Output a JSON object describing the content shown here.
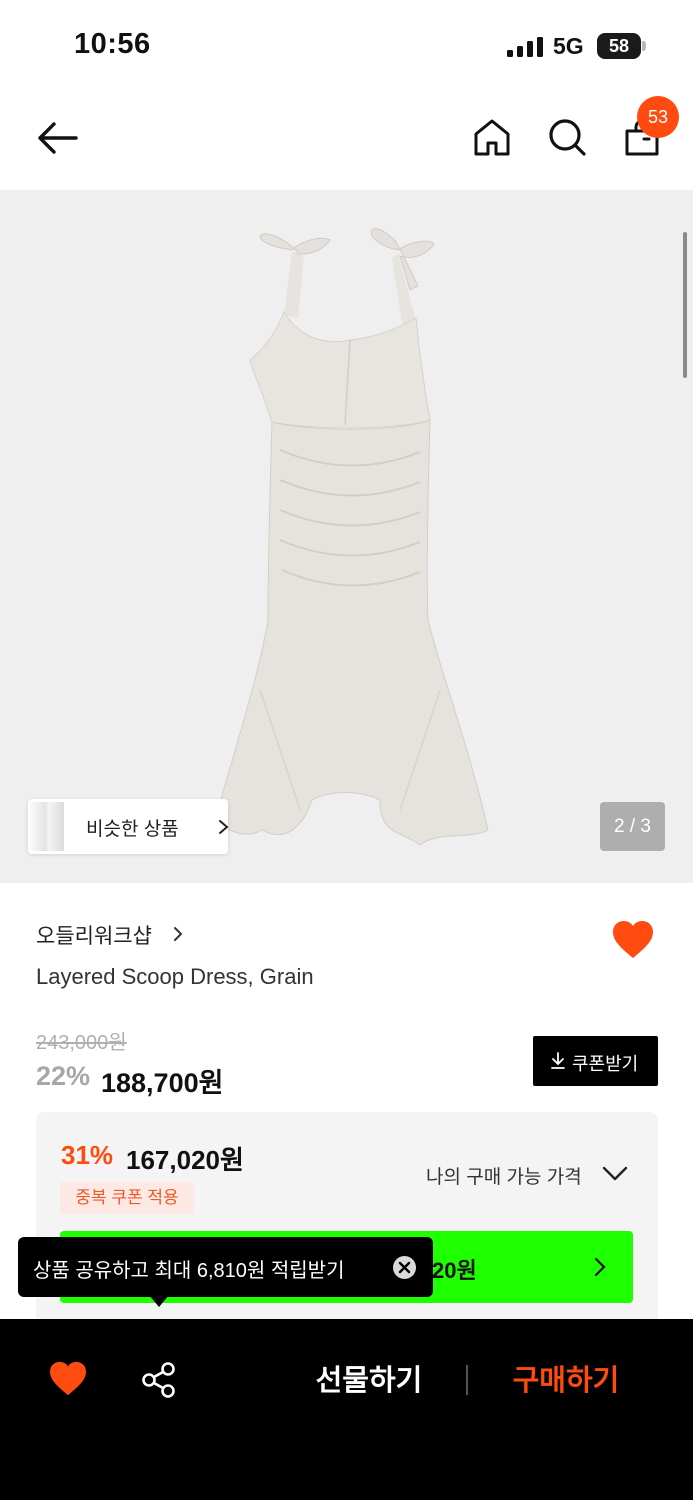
{
  "status_bar": {
    "time": "10:56",
    "network": "5G",
    "battery": "58"
  },
  "header": {
    "back_icon": "arrow-left-icon",
    "home_icon": "home-icon",
    "search_icon": "search-icon",
    "cart_icon": "shopping-bag-icon",
    "cart_badge": "53"
  },
  "product_image": {
    "similar_label": "비슷한 상품",
    "page_indicator": "2 / 3"
  },
  "product": {
    "brand": "오들리워크샵",
    "name": "Layered Scoop Dress, Grain",
    "original_price": "243,000원",
    "discount_rate": "22%",
    "sale_price": "188,700원",
    "coupon_label": "쿠폰받기",
    "wishlisted": true
  },
  "my_price": {
    "rate": "31%",
    "price": "167,020원",
    "label": "나의 구매 가능 가격",
    "tag": "중복 쿠폰 적용",
    "button_text": "20원"
  },
  "tooltip": {
    "text": "상품 공유하고 최대 6,810원 적립받기"
  },
  "bottom_bar": {
    "gift_label": "선물하기",
    "buy_label": "구매하기"
  },
  "colors": {
    "accent": "#ff4b0f",
    "green": "#1eff00",
    "background": "#efefef"
  }
}
